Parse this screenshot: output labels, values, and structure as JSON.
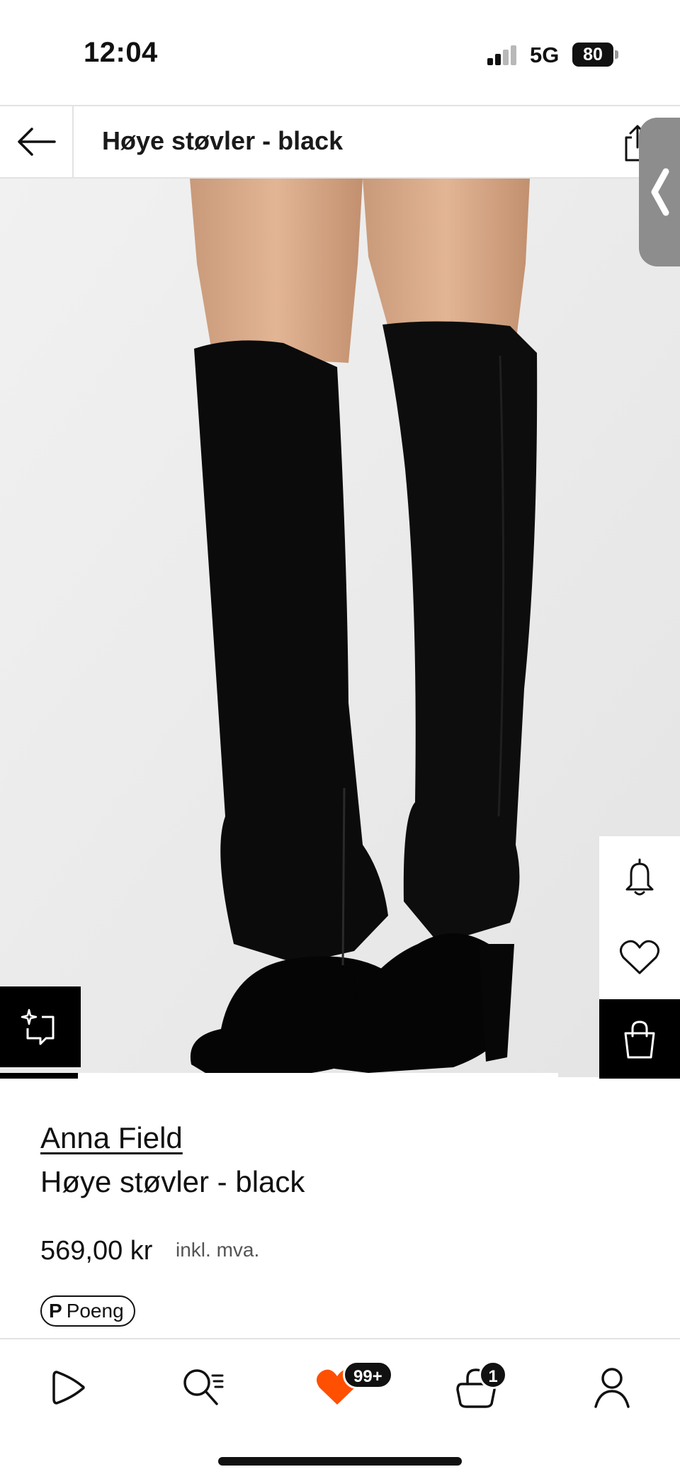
{
  "status_bar": {
    "time": "12:04",
    "network": "5G",
    "battery": "80"
  },
  "header": {
    "title": "Høye støvler - black"
  },
  "product": {
    "brand": "Anna Field",
    "name": "Høye støvler - black",
    "price": "569,00 kr",
    "vat_note": "inkl. mva.",
    "points_label": "Poeng",
    "points_glyph": "P",
    "gallery_progress": 0.14
  },
  "bottom_nav": {
    "wishlist_badge": "99+",
    "cart_badge": "1"
  },
  "icons": {
    "back": "arrow-left-icon",
    "share": "share-icon",
    "side_tab": "chevron-left-icon",
    "try_on": "sparkle-frame-icon",
    "notify": "bell-icon",
    "wishlist": "heart-icon",
    "add_to_bag": "bag-icon",
    "nav_home": "play-icon",
    "nav_search": "search-icon",
    "nav_wishlist": "heart-filled-icon",
    "nav_cart": "bag-icon",
    "nav_profile": "person-icon"
  },
  "colors": {
    "accent": "#ff4f00",
    "text": "#111111",
    "image_background": "#ececec"
  }
}
